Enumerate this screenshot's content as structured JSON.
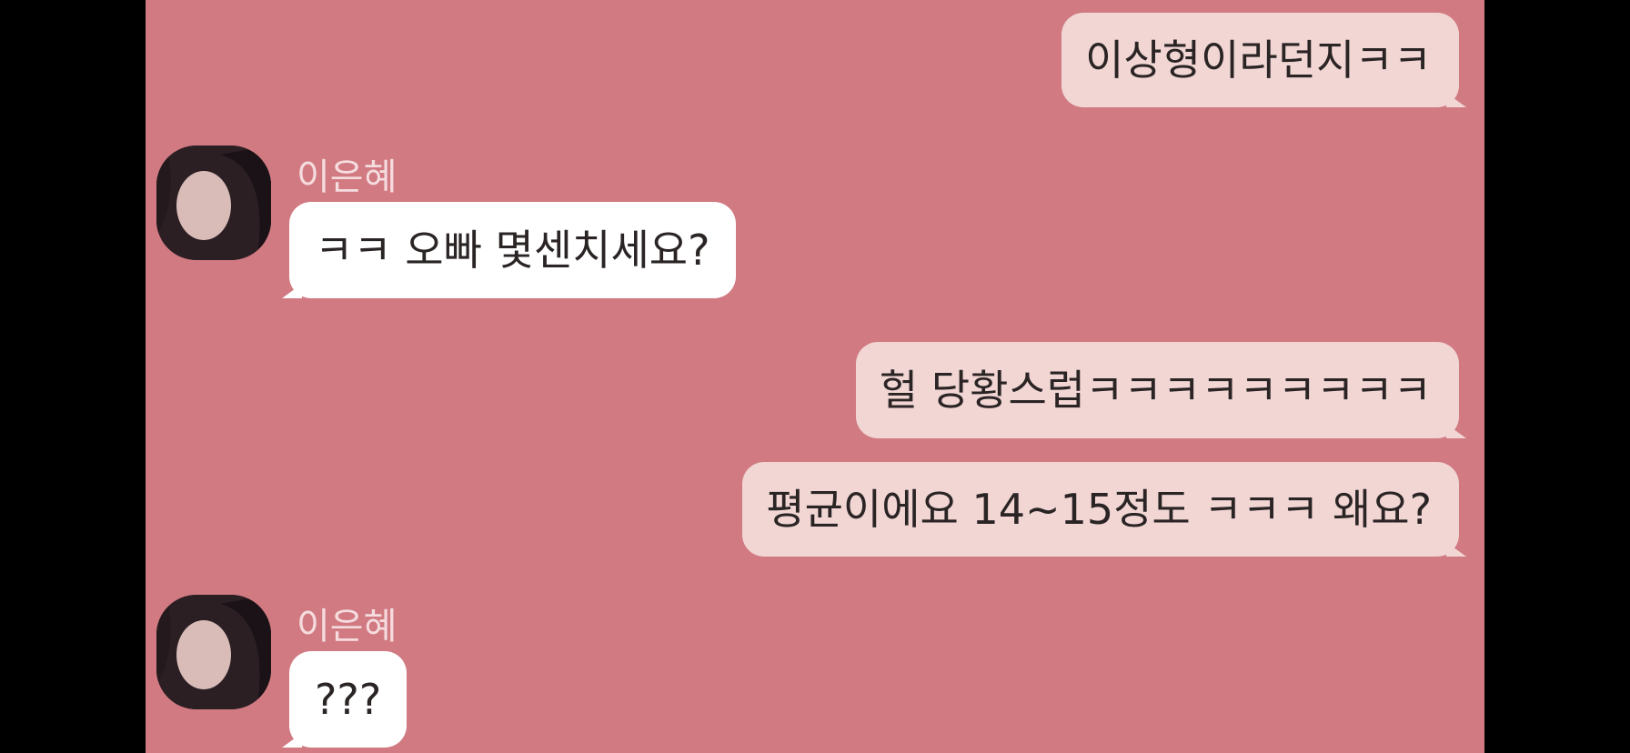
{
  "messages": [
    {
      "side": "me",
      "text": "이상형이라던지ㅋㅋ"
    },
    {
      "side": "other",
      "sender": "이은혜",
      "text": "ㅋㅋ 오빠 몇센치세요?"
    },
    {
      "side": "me",
      "text": "헐 당황스럽ㅋㅋㅋㅋㅋㅋㅋㅋㅋ"
    },
    {
      "side": "me",
      "text": "평균이에요 14~15정도 ㅋㅋㅋ 왜요?"
    },
    {
      "side": "other",
      "sender": "이은혜",
      "text": "???"
    }
  ],
  "colors": {
    "chat_background": "#d17a82",
    "my_bubble": "#f1d6d4",
    "other_bubble": "#ffffff",
    "sender_name": "#f5dcde",
    "side_bars": "#000000"
  },
  "icons": {
    "avatar": "profile-photo-avatar"
  }
}
